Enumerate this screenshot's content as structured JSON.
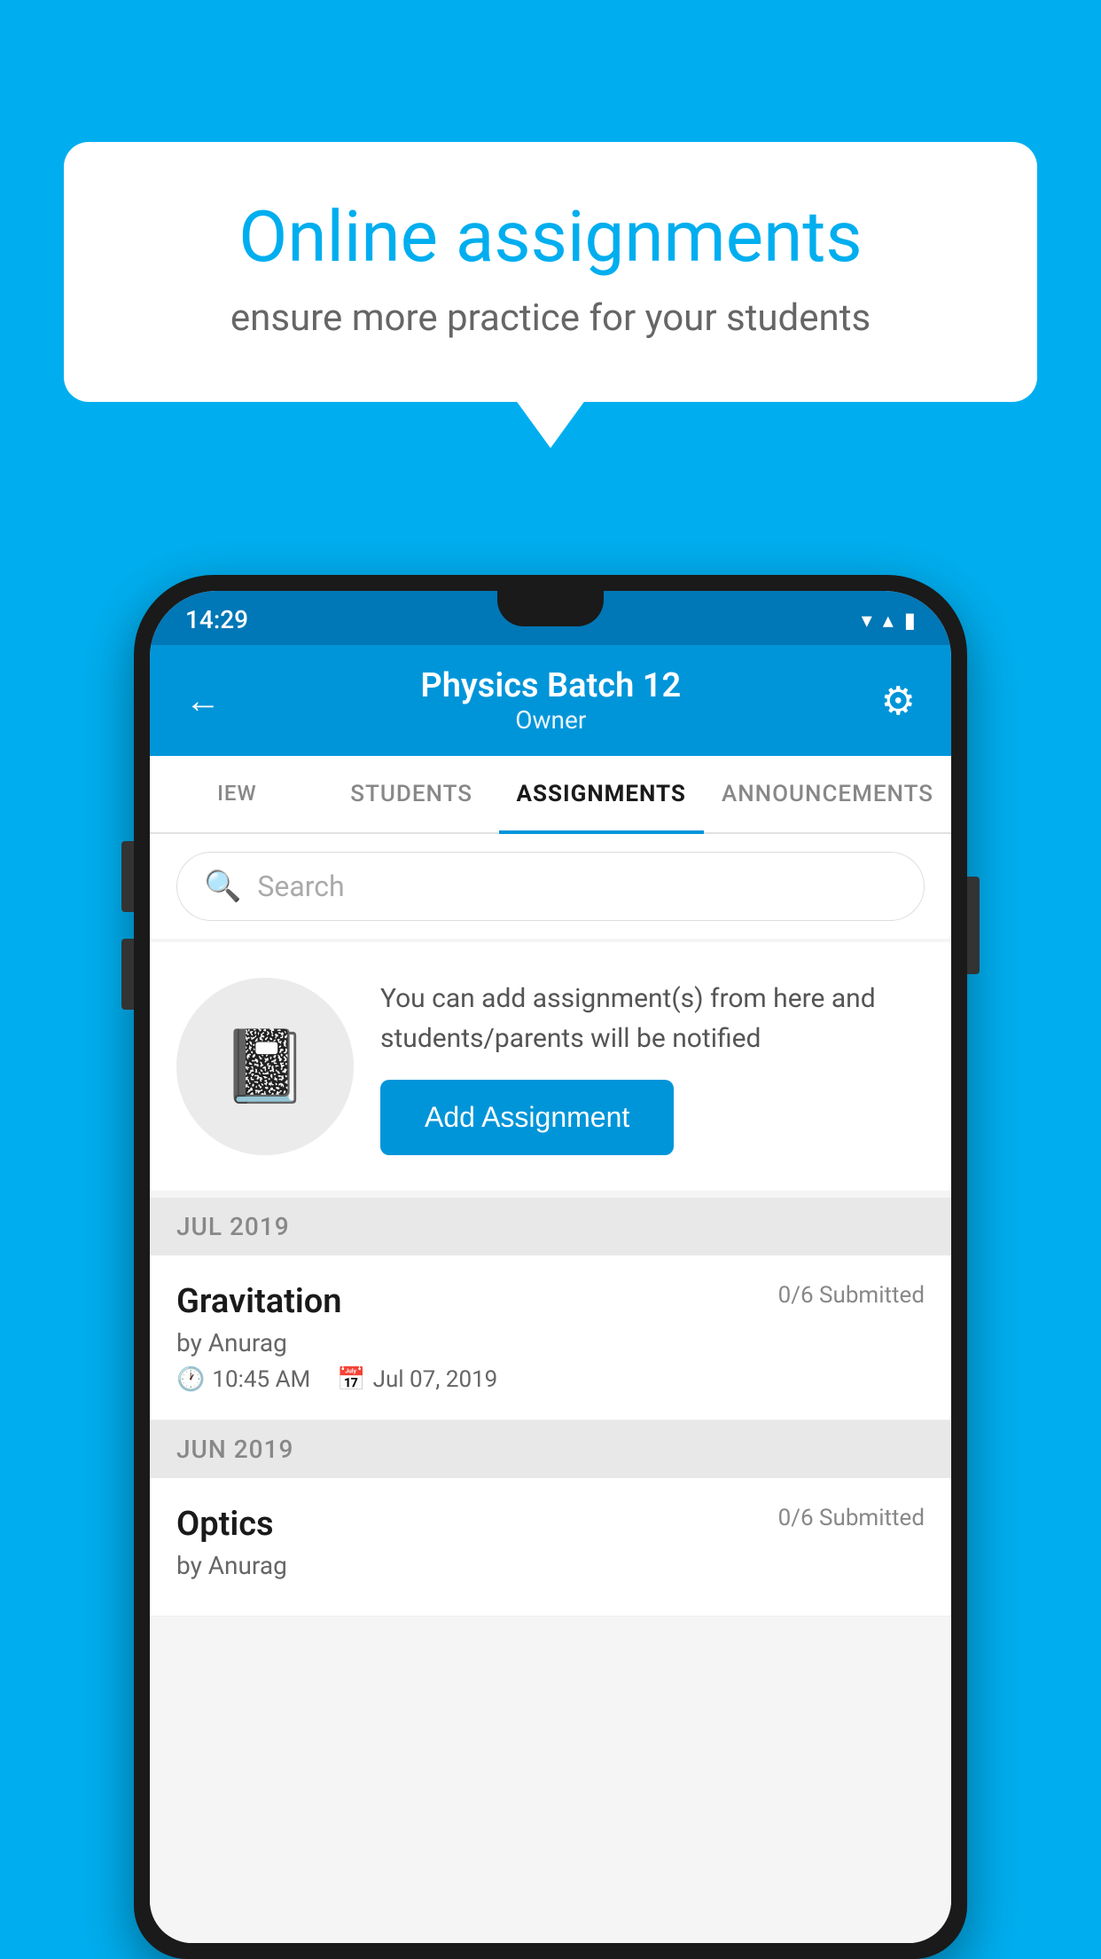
{
  "background": {
    "color": "#00AEEF"
  },
  "speech_bubble": {
    "title": "Online assignments",
    "subtitle": "ensure more practice for your students"
  },
  "status_bar": {
    "time": "14:29",
    "wifi_icon": "▼",
    "signal_icon": "▲",
    "battery_icon": "▮"
  },
  "top_bar": {
    "title": "Physics Batch 12",
    "subtitle": "Owner",
    "back_label": "←",
    "settings_label": "⚙"
  },
  "tabs": [
    {
      "label": "IEW",
      "active": false
    },
    {
      "label": "STUDENTS",
      "active": false
    },
    {
      "label": "ASSIGNMENTS",
      "active": true
    },
    {
      "label": "ANNOUNCEMENTS",
      "active": false
    }
  ],
  "search": {
    "placeholder": "Search"
  },
  "promo": {
    "text": "You can add assignment(s) from here and students/parents will be notified",
    "button_label": "Add Assignment"
  },
  "months": [
    {
      "label": "JUL 2019",
      "assignments": [
        {
          "name": "Gravitation",
          "submitted": "0/6 Submitted",
          "author": "by Anurag",
          "time": "10:45 AM",
          "date": "Jul 07, 2019"
        }
      ]
    },
    {
      "label": "JUN 2019",
      "assignments": [
        {
          "name": "Optics",
          "submitted": "0/6 Submitted",
          "author": "by Anurag",
          "time": "",
          "date": ""
        }
      ]
    }
  ]
}
